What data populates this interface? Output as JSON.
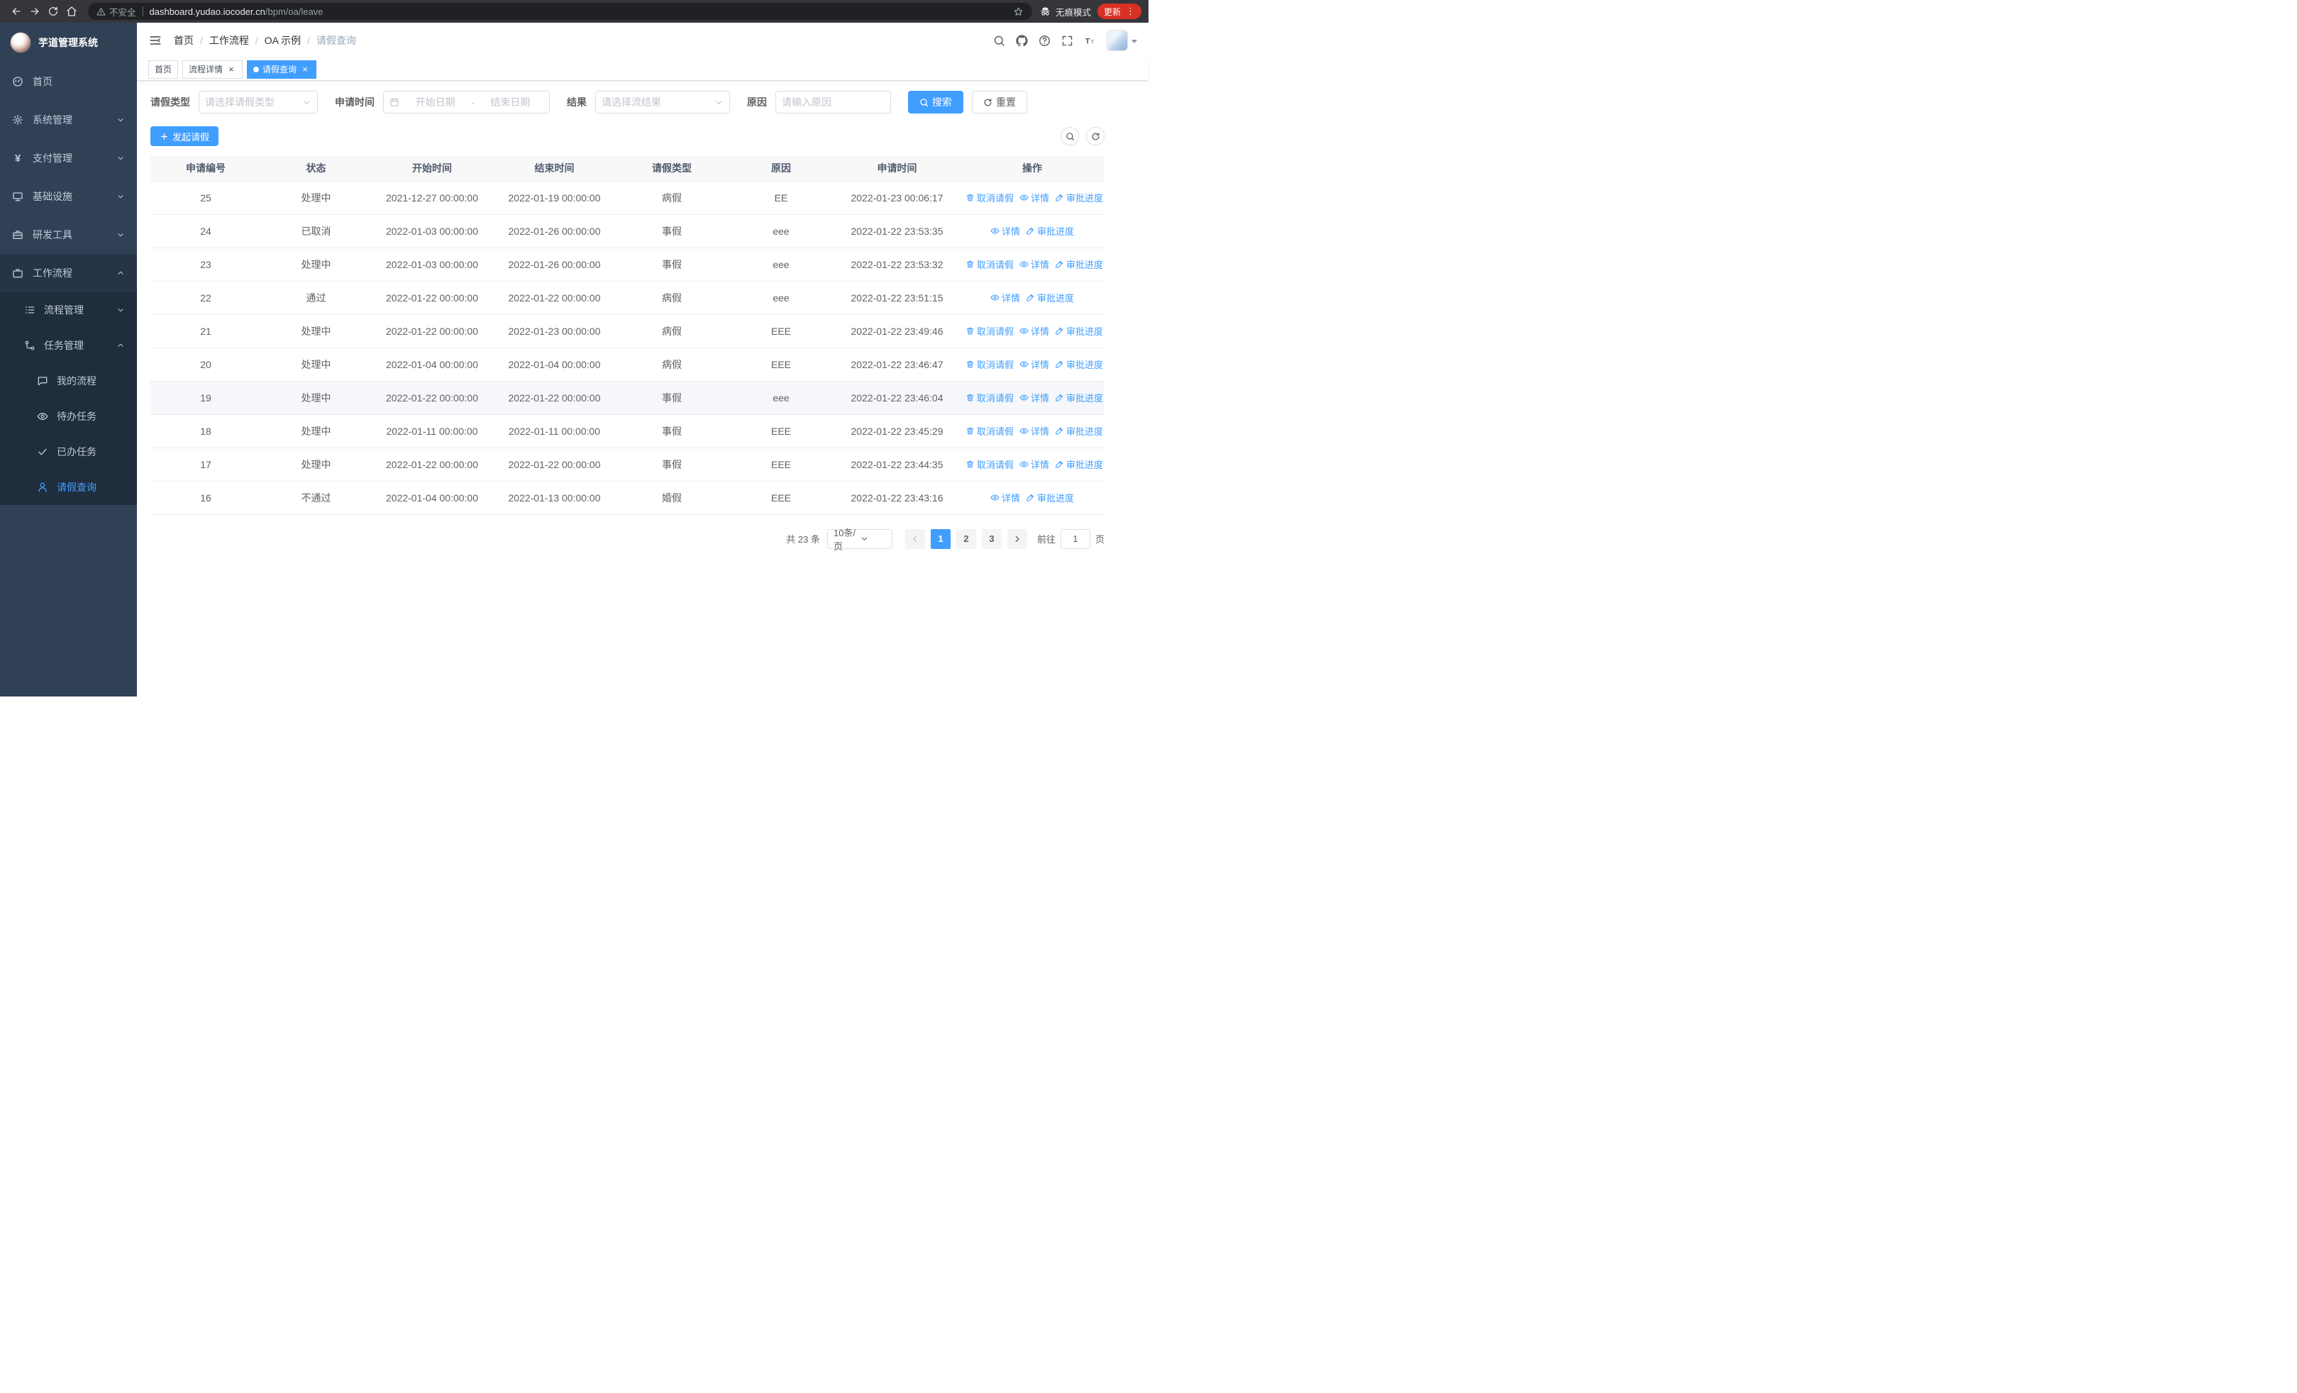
{
  "colors": {
    "primary": "#409eff",
    "sidebar_bg": "#304156",
    "sidebar_sub_bg": "#1f2d3d",
    "danger": "#d93025"
  },
  "browser": {
    "security_label": "不安全",
    "url_host": "dashboard.yudao.iocoder.cn",
    "url_path": "/bpm/oa/leave",
    "incognito_label": "无痕模式",
    "update_label": "更新"
  },
  "sidebar": {
    "logo_title": "芋道管理系统",
    "items": [
      {
        "name": "home",
        "label": "首页",
        "icon": "dashboard"
      },
      {
        "name": "system",
        "label": "系统管理",
        "icon": "gear",
        "chevron": "down"
      },
      {
        "name": "payment",
        "label": "支付管理",
        "icon": "yen",
        "chevron": "down"
      },
      {
        "name": "infra",
        "label": "基础设施",
        "icon": "monitor",
        "chevron": "down"
      },
      {
        "name": "devtools",
        "label": "研发工具",
        "icon": "toolbox",
        "chevron": "down"
      },
      {
        "name": "workflow",
        "label": "工作流程",
        "icon": "briefcase",
        "chevron": "up",
        "highlighted": true
      }
    ],
    "submenu": [
      {
        "name": "process-mgmt",
        "label": "流程管理",
        "icon": "list",
        "chevron": "down",
        "level": 1
      },
      {
        "name": "task-mgmt",
        "label": "任务管理",
        "icon": "flow",
        "chevron": "up",
        "level": 1
      },
      {
        "name": "my-process",
        "label": "我的流程",
        "icon": "chat",
        "level": 2
      },
      {
        "name": "todo-tasks",
        "label": "待办任务",
        "icon": "eye",
        "level": 2
      },
      {
        "name": "done-tasks",
        "label": "已办任务",
        "icon": "check",
        "level": 2
      },
      {
        "name": "leave-query",
        "label": "请假查询",
        "icon": "user",
        "level": 2,
        "active": true
      }
    ]
  },
  "header": {
    "breadcrumb": [
      "首页",
      "工作流程",
      "OA 示例",
      "请假查询"
    ]
  },
  "tabs": [
    {
      "name": "home",
      "label": "首页",
      "closable": false,
      "active": false
    },
    {
      "name": "process-detail",
      "label": "流程详情",
      "closable": true,
      "active": false
    },
    {
      "name": "leave-query",
      "label": "请假查询",
      "closable": true,
      "active": true
    }
  ],
  "filters": {
    "leave_type_label": "请假类型",
    "leave_type_placeholder": "请选择请假类型",
    "apply_time_label": "申请时间",
    "start_date_placeholder": "开始日期",
    "date_separator": "-",
    "end_date_placeholder": "结束日期",
    "result_label": "结果",
    "result_placeholder": "请选择流结果",
    "reason_label": "原因",
    "reason_placeholder": "请输入原因",
    "search_button": "搜索",
    "reset_button": "重置"
  },
  "toolbar": {
    "create_button": "发起请假"
  },
  "table": {
    "columns": [
      "申请编号",
      "状态",
      "开始时间",
      "结束时间",
      "请假类型",
      "原因",
      "申请时间",
      "操作"
    ],
    "action_cancel": "取消请假",
    "action_detail": "详情",
    "action_progress": "审批进度",
    "rows": [
      {
        "id": "25",
        "status": "处理中",
        "start": "2021-12-27 00:00:00",
        "end": "2022-01-19 00:00:00",
        "type": "病假",
        "reason": "EE",
        "applied": "2022-01-23 00:06:17",
        "cancellable": true
      },
      {
        "id": "24",
        "status": "已取消",
        "start": "2022-01-03 00:00:00",
        "end": "2022-01-26 00:00:00",
        "type": "事假",
        "reason": "eee",
        "applied": "2022-01-22 23:53:35",
        "cancellable": false
      },
      {
        "id": "23",
        "status": "处理中",
        "start": "2022-01-03 00:00:00",
        "end": "2022-01-26 00:00:00",
        "type": "事假",
        "reason": "eee",
        "applied": "2022-01-22 23:53:32",
        "cancellable": true
      },
      {
        "id": "22",
        "status": "通过",
        "start": "2022-01-22 00:00:00",
        "end": "2022-01-22 00:00:00",
        "type": "病假",
        "reason": "eee",
        "applied": "2022-01-22 23:51:15",
        "cancellable": false
      },
      {
        "id": "21",
        "status": "处理中",
        "start": "2022-01-22 00:00:00",
        "end": "2022-01-23 00:00:00",
        "type": "病假",
        "reason": "EEE",
        "applied": "2022-01-22 23:49:46",
        "cancellable": true
      },
      {
        "id": "20",
        "status": "处理中",
        "start": "2022-01-04 00:00:00",
        "end": "2022-01-04 00:00:00",
        "type": "病假",
        "reason": "EEE",
        "applied": "2022-01-22 23:46:47",
        "cancellable": true
      },
      {
        "id": "19",
        "status": "处理中",
        "start": "2022-01-22 00:00:00",
        "end": "2022-01-22 00:00:00",
        "type": "事假",
        "reason": "eee",
        "applied": "2022-01-22 23:46:04",
        "cancellable": true,
        "highlighted": true
      },
      {
        "id": "18",
        "status": "处理中",
        "start": "2022-01-11 00:00:00",
        "end": "2022-01-11 00:00:00",
        "type": "事假",
        "reason": "EEE",
        "applied": "2022-01-22 23:45:29",
        "cancellable": true
      },
      {
        "id": "17",
        "status": "处理中",
        "start": "2022-01-22 00:00:00",
        "end": "2022-01-22 00:00:00",
        "type": "事假",
        "reason": "EEE",
        "applied": "2022-01-22 23:44:35",
        "cancellable": true
      },
      {
        "id": "16",
        "status": "不通过",
        "start": "2022-01-04 00:00:00",
        "end": "2022-01-13 00:00:00",
        "type": "婚假",
        "reason": "EEE",
        "applied": "2022-01-22 23:43:16",
        "cancellable": false
      }
    ]
  },
  "pagination": {
    "total_label": "共 23 条",
    "size_label": "10条/页",
    "pages": [
      "1",
      "2",
      "3"
    ],
    "active_page": "1",
    "prev_disabled": true,
    "goto_label": "前往",
    "goto_value": "1",
    "page_suffix": "页"
  }
}
